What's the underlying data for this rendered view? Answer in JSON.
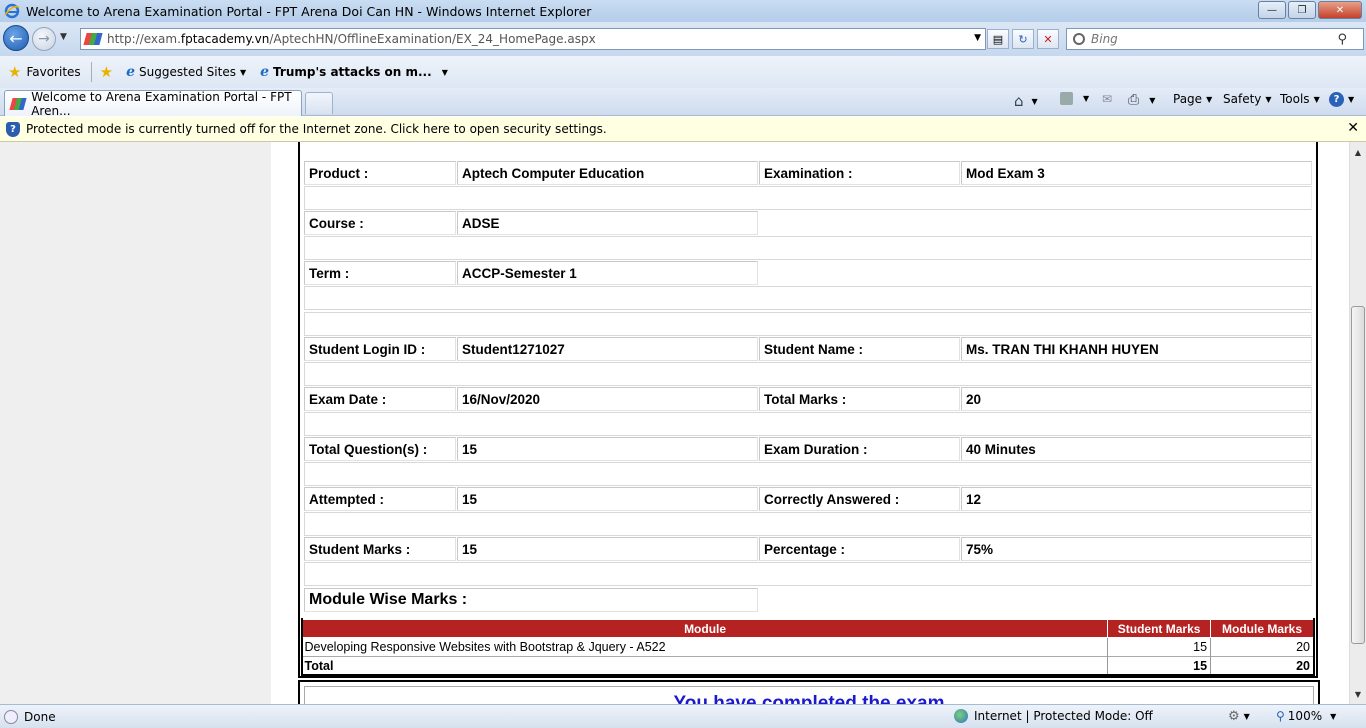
{
  "window": {
    "title": "Welcome to Arena Examination Portal - FPT Arena Doi Can HN - Windows Internet Explorer"
  },
  "address": {
    "url_prefix": "http://exam.",
    "url_domain": "fptacademy.vn",
    "url_path": "/AptechHN/OfflineExamination/EX_24_HomePage.aspx",
    "search_placeholder": "Bing"
  },
  "favorites": {
    "favorites_label": "Favorites",
    "suggested_label": "Suggested Sites",
    "news_label": "Trump's attacks on m..."
  },
  "tabs": {
    "active_tab": "Welcome to Arena Examination Portal - FPT Aren..."
  },
  "commands": {
    "page": "Page",
    "safety": "Safety",
    "tools": "Tools"
  },
  "infobar": {
    "message": "Protected mode is currently turned off for the Internet zone.  Click here to open security settings."
  },
  "exam": {
    "product_label": "Product :",
    "product_value": "Aptech Computer Education",
    "examination_label": "Examination :",
    "examination_value": "Mod Exam 3",
    "course_label": "Course :",
    "course_value": "ADSE",
    "term_label": "Term :",
    "term_value": "ACCP-Semester 1",
    "login_label": "Student Login ID :",
    "login_value": "Student1271027",
    "name_label": "Student Name :",
    "name_value": "Ms. TRAN THI KHANH HUYEN",
    "date_label": "Exam Date :",
    "date_value": "16/Nov/2020",
    "total_marks_label": "Total Marks :",
    "total_marks_value": "20",
    "questions_label": "Total Question(s) :",
    "questions_value": "15",
    "duration_label": "Exam Duration :",
    "duration_value": "40 Minutes",
    "attempted_label": "Attempted :",
    "attempted_value": "15",
    "correct_label": "Correctly Answered :",
    "correct_value": "12",
    "student_marks_label": "Student Marks :",
    "student_marks_value": "15",
    "percentage_label": "Percentage :",
    "percentage_value": "75%",
    "module_wise_label": "Module Wise Marks :"
  },
  "module_table": {
    "headers": [
      "Module",
      "Student Marks",
      "Module Marks"
    ],
    "rows": [
      {
        "module": "Developing Responsive Websites with Bootstrap & Jquery - A522",
        "student_marks": "15",
        "module_marks": "20"
      }
    ],
    "total": {
      "label": "Total",
      "student_marks": "15",
      "module_marks": "20"
    }
  },
  "completion": {
    "message": "You have completed the exam"
  },
  "status": {
    "left": "Done",
    "zone": "Internet | Protected Mode: Off",
    "zoom": "100%"
  }
}
